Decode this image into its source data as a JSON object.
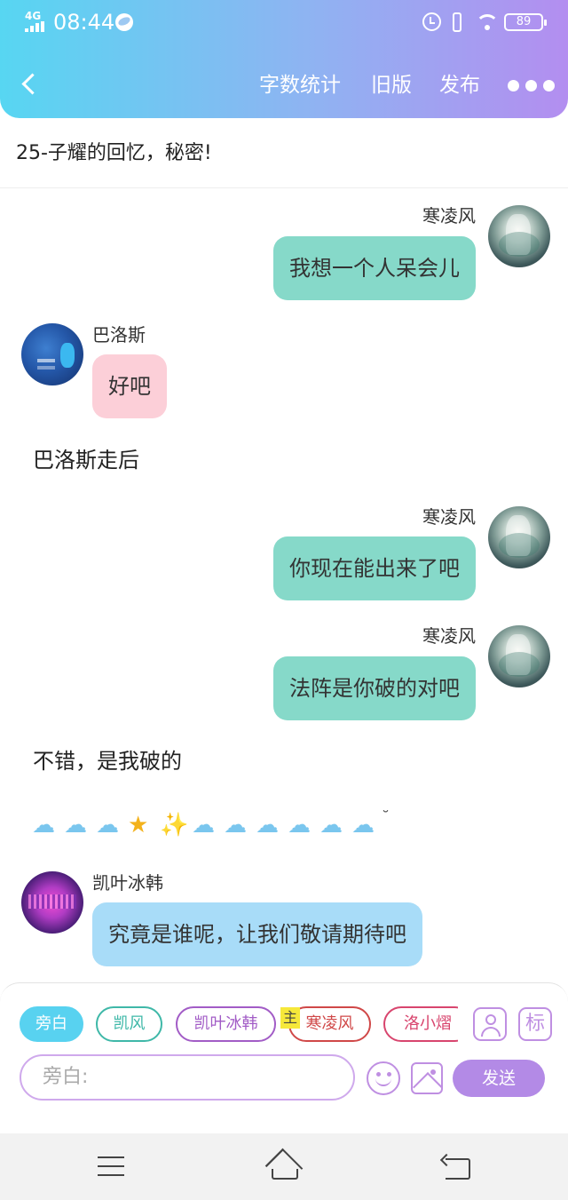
{
  "status_bar": {
    "network": "4G",
    "time": "08:44",
    "battery": "89"
  },
  "header": {
    "word_count_label": "字数统计",
    "old_version_label": "旧版",
    "publish_label": "发布"
  },
  "story_title": "25-子耀的回忆，秘密!",
  "messages": [
    {
      "type": "right",
      "name": "寒凌风",
      "text": "我想一个人呆会儿"
    },
    {
      "type": "left",
      "name": "巴洛斯",
      "text": "好吧"
    },
    {
      "type": "narration",
      "text": "巴洛斯走后"
    },
    {
      "type": "right",
      "name": "寒凌风",
      "text": "你现在能出来了吧"
    },
    {
      "type": "right",
      "name": "寒凌风",
      "text": "法阵是你破的对吧"
    },
    {
      "type": "narration",
      "text": "不错，是我破的"
    },
    {
      "type": "emoji_row",
      "glyphs": [
        "☁",
        "☁",
        "☁",
        "★",
        "✨",
        "☁",
        "☁",
        "☁",
        "☁",
        "☁",
        "☁",
        "˘"
      ]
    },
    {
      "type": "left",
      "name": "凯叶冰韩",
      "text": "究竟是谁呢，让我们敬请期待吧"
    }
  ],
  "role_chips": [
    {
      "label": "旁白",
      "color": "#58d2f0",
      "selected": true
    },
    {
      "label": "凯风",
      "color": "#3fb8a8",
      "selected": false
    },
    {
      "label": "凯叶冰韩",
      "color": "#a25cc6",
      "selected": false
    },
    {
      "label": "寒凌风",
      "color": "#d04848",
      "selected": false
    },
    {
      "label": "洛小熠",
      "color": "#d8456e",
      "selected": false
    }
  ],
  "host_tag": "主",
  "tag_button_label": "标",
  "input": {
    "placeholder": "旁白:"
  },
  "send_label": "发送",
  "icons": {
    "back": "chevron-left-icon",
    "more": "more-dots-icon",
    "role_manage": "person-icon",
    "emoji": "smiley-icon",
    "image": "image-icon",
    "nav_menu": "menu-icon",
    "nav_home": "home-icon",
    "nav_back": "back-arrow-icon"
  },
  "colors": {
    "header_gradient": [
      "#57d6f2",
      "#b38ef0"
    ],
    "right_bubble": "#86d9c9",
    "pink_bubble": "#fccfd8",
    "blue_bubble": "#a8dcf8",
    "accent": "#b38ae6"
  }
}
